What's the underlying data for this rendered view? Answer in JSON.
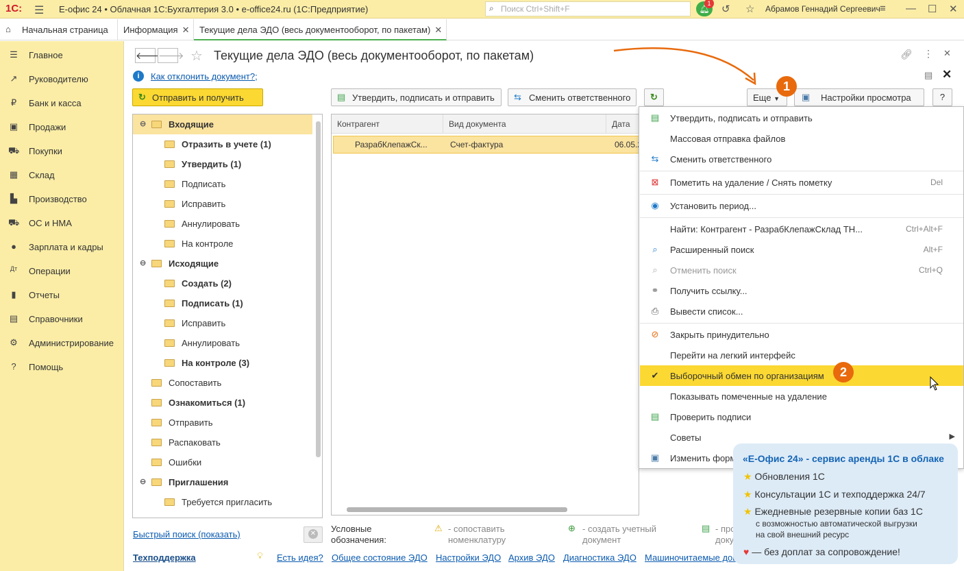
{
  "app": {
    "logo": "1С:",
    "title": "Е-офис 24 • Облачная 1С:Бухгалтерия 3.0 • e-office24.ru  (1С:Предприятие)",
    "search_placeholder": "Поиск Ctrl+Shift+F",
    "notifications_count": "1",
    "user": "Абрамов Геннадий Сергеевич"
  },
  "tabs": [
    {
      "label": "Начальная страница"
    },
    {
      "label": "Информация"
    },
    {
      "label": "Текущие дела ЭДО (весь документооборот, по пакетам)"
    }
  ],
  "sidebar": {
    "items": [
      {
        "label": "Главное",
        "icon": "menu-icon"
      },
      {
        "label": "Руководителю",
        "icon": "chart-icon"
      },
      {
        "label": "Банк и касса",
        "icon": "ruble-icon"
      },
      {
        "label": "Продажи",
        "icon": "bag-icon"
      },
      {
        "label": "Покупки",
        "icon": "cart-icon"
      },
      {
        "label": "Склад",
        "icon": "warehouse-icon"
      },
      {
        "label": "Производство",
        "icon": "factory-icon"
      },
      {
        "label": "ОС и НМА",
        "icon": "truck-icon"
      },
      {
        "label": "Зарплата и кадры",
        "icon": "person-icon"
      },
      {
        "label": "Операции",
        "icon": "operations-icon"
      },
      {
        "label": "Отчеты",
        "icon": "report-icon"
      },
      {
        "label": "Справочники",
        "icon": "book-icon"
      },
      {
        "label": "Администрирование",
        "icon": "gear-icon"
      },
      {
        "label": "Помощь",
        "icon": "help-icon"
      }
    ]
  },
  "page": {
    "title": "Текущие дела ЭДО (весь документооборот, по пакетам)",
    "help_link": "Как отклонить документ?",
    "help_suffix": ";",
    "send_receive": "Отправить и получить",
    "approve_sign_send": "Утвердить, подписать и отправить",
    "change_responsible": "Сменить ответственного",
    "more": "Еще",
    "view_settings": "Настройки просмотра",
    "help": "?"
  },
  "tree": [
    {
      "label": "Входящие",
      "level": 0,
      "bold": true,
      "collapse": true
    },
    {
      "label": "Отразить в учете (1)",
      "level": 1,
      "bold": true
    },
    {
      "label": "Утвердить (1)",
      "level": 1,
      "bold": true
    },
    {
      "label": "Подписать",
      "level": 1,
      "bold": false
    },
    {
      "label": "Исправить",
      "level": 1,
      "bold": false
    },
    {
      "label": "Аннулировать",
      "level": 1,
      "bold": false
    },
    {
      "label": "На контроле",
      "level": 1,
      "bold": false
    },
    {
      "label": "Исходящие",
      "level": 0,
      "bold": true,
      "collapse": true
    },
    {
      "label": "Создать (2)",
      "level": 1,
      "bold": true
    },
    {
      "label": "Подписать (1)",
      "level": 1,
      "bold": true
    },
    {
      "label": "Исправить",
      "level": 1,
      "bold": false
    },
    {
      "label": "Аннулировать",
      "level": 1,
      "bold": false
    },
    {
      "label": "На контроле (3)",
      "level": 1,
      "bold": true
    },
    {
      "label": "Сопоставить",
      "level": 0,
      "bold": false
    },
    {
      "label": "Ознакомиться (1)",
      "level": 0,
      "bold": true
    },
    {
      "label": "Отправить",
      "level": 0,
      "bold": false
    },
    {
      "label": "Распаковать",
      "level": 0,
      "bold": false
    },
    {
      "label": "Ошибки",
      "level": 0,
      "bold": false
    },
    {
      "label": "Приглашения",
      "level": 0,
      "bold": true,
      "collapse": true
    },
    {
      "label": "Требуется пригласить",
      "level": 1,
      "bold": false
    }
  ],
  "grid": {
    "columns": [
      "Контрагент",
      "Вид документа",
      "Дата"
    ],
    "rows": [
      {
        "counterparty": "РазрабКлепажСк...",
        "doc_type": "Счет-фактура",
        "date": "06.05.2"
      }
    ]
  },
  "menu": [
    {
      "label": "Утвердить, подписать и отправить",
      "icon": "approve-icon",
      "shortcut": ""
    },
    {
      "label": "Массовая отправка файлов",
      "icon": "",
      "shortcut": ""
    },
    {
      "label": "Сменить ответственного",
      "icon": "change-responsible-icon",
      "shortcut": ""
    },
    {
      "sep": true
    },
    {
      "label": "Пометить на удаление / Снять пометку",
      "icon": "delete-mark-icon",
      "shortcut": "Del"
    },
    {
      "sep": true
    },
    {
      "label": "Установить период...",
      "icon": "period-icon",
      "shortcut": ""
    },
    {
      "sep": true
    },
    {
      "label": "Найти: Контрагент - РазрабКлепажСклад ТН...",
      "icon": "",
      "shortcut": "Ctrl+Alt+F"
    },
    {
      "label": "Расширенный поиск",
      "icon": "search-icon",
      "shortcut": "Alt+F"
    },
    {
      "label": "Отменить поиск",
      "icon": "cancel-search-icon",
      "shortcut": "Ctrl+Q",
      "disabled": true
    },
    {
      "label": "Получить ссылку...",
      "icon": "link-icon",
      "shortcut": ""
    },
    {
      "label": "Вывести список...",
      "icon": "print-icon",
      "shortcut": ""
    },
    {
      "sep": true
    },
    {
      "label": "Закрыть принудительно",
      "icon": "force-close-icon",
      "shortcut": ""
    },
    {
      "label": "Перейти на легкий интерфейс",
      "icon": "",
      "shortcut": ""
    },
    {
      "label": "Выборочный обмен по организациям",
      "icon": "check-icon",
      "shortcut": "",
      "highlighted": true
    },
    {
      "label": "Показывать помеченные на удаление",
      "icon": "",
      "shortcut": ""
    },
    {
      "label": "Проверить подписи",
      "icon": "verify-signature-icon",
      "shortcut": ""
    },
    {
      "label": "Советы",
      "icon": "",
      "shortcut": "",
      "submenu": true
    },
    {
      "label": "Изменить форм",
      "icon": "change-form-icon",
      "shortcut": ""
    }
  ],
  "markers": {
    "one": "1",
    "two": "2"
  },
  "promo": {
    "title": "«Е-Офис 24» - сервис аренды 1С в облаке",
    "lines": [
      "Обновления 1С",
      "Консультации 1С и техподдержка 24/7",
      "Ежедневные резервные копии баз 1С"
    ],
    "sub1": "с возможностью автоматической выгрузки",
    "sub2": "на свой внешний ресурс",
    "last": "— без доплат за сопровождение!"
  },
  "bottom": {
    "quick_search": "Быстрый поиск (показать)",
    "legend_label1": "Условные",
    "legend_label2": "обозначения:",
    "leg1a": "- сопоставить",
    "leg1b": "номенклатуру",
    "leg2a": "- создать учетный",
    "leg2b": "документ",
    "leg3a": "- про",
    "leg3b": "доку",
    "support": "Техподдержка",
    "links": [
      "Есть идея?",
      "Общее состояние ЭДО",
      "Настройки ЭДО",
      "Архив ЭДО",
      "Диагностика ЭДО",
      "Машиночитаемые дов"
    ]
  },
  "colors": {
    "accent": "#fbd832",
    "panel": "#fbeda6",
    "selection": "#fbe3a0",
    "marker": "#e86a0d",
    "link": "#0b5bb0"
  }
}
